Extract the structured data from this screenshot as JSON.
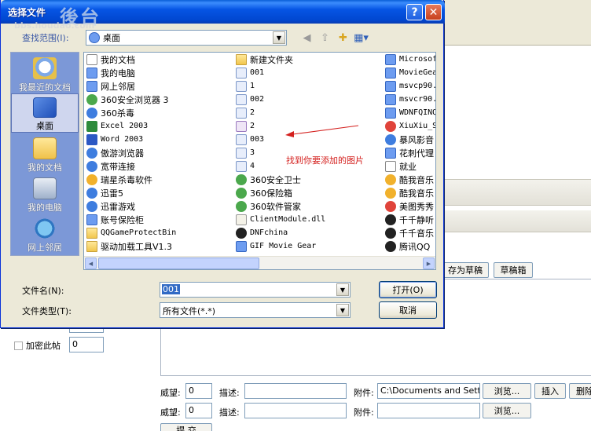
{
  "dialog": {
    "title": "选择文件",
    "help_glyph": "?",
    "close_glyph": "✕",
    "watermark_big": "後台",
    "watermark_url": "bbs.houdao.com",
    "look_in_label": "查找范围(I):",
    "look_in_value": "桌面",
    "places": [
      {
        "label": "我最近的文档"
      },
      {
        "label": "桌面"
      },
      {
        "label": "我的文档"
      },
      {
        "label": "我的电脑"
      },
      {
        "label": "网上邻居"
      }
    ],
    "files_col1": [
      {
        "name": "我的文档",
        "icon": "doc"
      },
      {
        "name": "我的电脑",
        "icon": "app"
      },
      {
        "name": "网上邻居",
        "icon": "app"
      },
      {
        "name": "360安全浏览器 3",
        "icon": "green"
      },
      {
        "name": "360杀毒",
        "icon": "blue"
      },
      {
        "name": "Excel 2003",
        "icon": "xls",
        "mono": true
      },
      {
        "name": "Word 2003",
        "icon": "word",
        "mono": true
      },
      {
        "name": "傲游浏览器",
        "icon": "blue"
      },
      {
        "name": "宽带连接",
        "icon": "blue"
      },
      {
        "name": "瑞星杀毒软件",
        "icon": "gold"
      },
      {
        "name": "迅雷5",
        "icon": "blue"
      },
      {
        "name": "迅雷游戏",
        "icon": "blue"
      },
      {
        "name": "账号保险柜",
        "icon": "app"
      },
      {
        "name": "QQGameProtectBin",
        "icon": "folder",
        "mono": true
      },
      {
        "name": "驱动加载工具V1.3",
        "icon": "folder"
      }
    ],
    "files_col2": [
      {
        "name": "新建文件夹",
        "icon": "folder"
      },
      {
        "name": "001",
        "icon": "jpg",
        "mono": true
      },
      {
        "name": "1",
        "icon": "jpg",
        "mono": true
      },
      {
        "name": "002",
        "icon": "jpg",
        "mono": true
      },
      {
        "name": "2",
        "icon": "jpg",
        "mono": true
      },
      {
        "name": "2",
        "icon": "png",
        "mono": true
      },
      {
        "name": "003",
        "icon": "jpg",
        "mono": true
      },
      {
        "name": "3",
        "icon": "jpg",
        "mono": true
      },
      {
        "name": "4",
        "icon": "jpg",
        "mono": true
      },
      {
        "name": "360安全卫士",
        "icon": "green"
      },
      {
        "name": "360保险箱",
        "icon": "green"
      },
      {
        "name": "360软件管家",
        "icon": "green"
      },
      {
        "name": "ClientModule.dll",
        "icon": "dll",
        "mono": true
      },
      {
        "name": "DNFchina",
        "icon": "black",
        "mono": true
      },
      {
        "name": "GIF Movie Gear",
        "icon": "app",
        "mono": true
      }
    ],
    "files_col3": [
      {
        "name": "Microsof",
        "icon": "app",
        "mono": true
      },
      {
        "name": "MovieGea",
        "icon": "app",
        "mono": true
      },
      {
        "name": "msvcp90.",
        "icon": "app",
        "mono": true
      },
      {
        "name": "msvcr90.",
        "icon": "app",
        "mono": true
      },
      {
        "name": "WDNFQINQ",
        "icon": "app",
        "mono": true
      },
      {
        "name": "XiuXiu_S",
        "icon": "red",
        "mono": true
      },
      {
        "name": "暴风影音",
        "icon": "blue"
      },
      {
        "name": "花刺代理",
        "icon": "app"
      },
      {
        "name": "就业",
        "icon": "doc"
      },
      {
        "name": "酷我音乐",
        "icon": "gold"
      },
      {
        "name": "酷我音乐",
        "icon": "gold"
      },
      {
        "name": "美图秀秀",
        "icon": "red"
      },
      {
        "name": "千千静听",
        "icon": "black"
      },
      {
        "name": "千千音乐",
        "icon": "black"
      },
      {
        "name": "腾讯QQ",
        "icon": "black"
      }
    ],
    "annotation": "找到你要添加的图片",
    "filename_label": "文件名(N):",
    "filename_value": "001",
    "filetype_label": "文件类型(T):",
    "filetype_value": "所有文件(*.*)",
    "open_button": "打开(O)",
    "cancel_button": "取消"
  },
  "page": {
    "save_draft_button": "存为草稿",
    "draft_box_button": "草稿箱",
    "encrypt_label": "加密此帖",
    "encrypt_value": "0",
    "row1": {
      "prestige_label": "威望:",
      "prestige_value": "0",
      "desc_label": "描述:",
      "attach_label": "附件:",
      "attach_value": "C:\\Documents and Sett",
      "browse_button": "浏览...",
      "insert_button": "插入",
      "delete_button": "删除"
    },
    "row2": {
      "prestige_label": "威望:",
      "prestige_value": "0",
      "desc_label": "描述:",
      "attach_label": "附件:",
      "browse_button": "浏览..."
    },
    "submit_button": "提 交"
  }
}
